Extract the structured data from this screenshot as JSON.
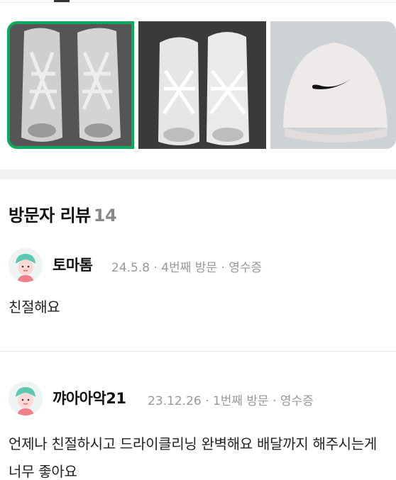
{
  "photos": [
    {
      "icon": "sneakers-photo-1",
      "selected": true
    },
    {
      "icon": "sneakers-photo-2",
      "selected": false
    },
    {
      "icon": "nike-cap-photo",
      "selected": false
    }
  ],
  "colors": {
    "accent": "#09aa5c",
    "muted": "#999999",
    "divider": "#f0f1f3"
  },
  "reviews_section": {
    "title": "방문자 리뷰",
    "count": "14"
  },
  "reviews": [
    {
      "nickname": "토마톰",
      "meta": "24.5.8 · 4번째 방문 · 영수증",
      "text": "친절해요"
    },
    {
      "nickname": "꺄아아악21",
      "meta": "23.12.26 · 1번째 방문 · 영수증",
      "text": "언제나 친절하시고 드라이클리닝 완벽해요 배달까지 해주시는게 너무 좋아요"
    }
  ]
}
